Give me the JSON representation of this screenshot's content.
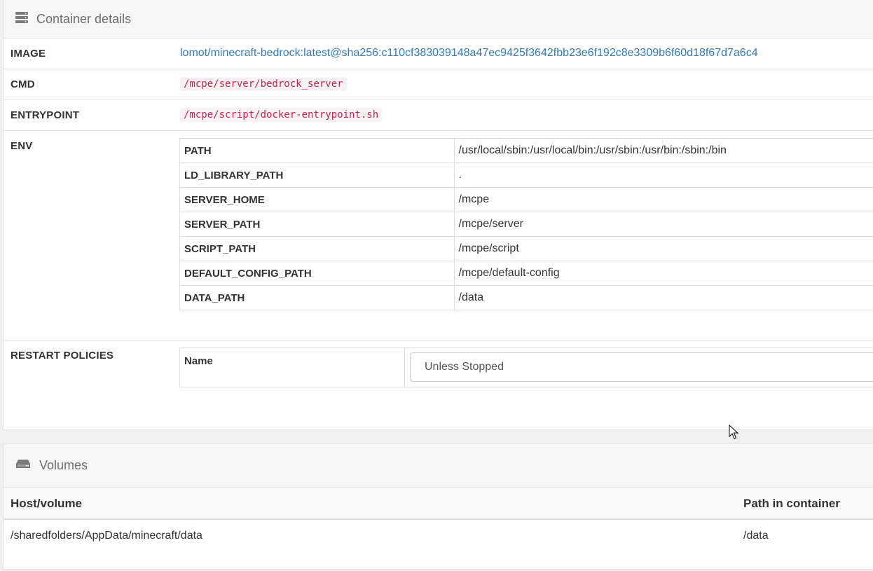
{
  "details": {
    "title": "Container details",
    "image_label": "IMAGE",
    "image_value": "lomot/minecraft-bedrock:latest@sha256:c110cf383039148a47ec9425f3642fbb23e6f192c8e3309b6f60d18f67d7a6c4",
    "cmd_label": "CMD",
    "cmd_value": "/mcpe/server/bedrock_server",
    "entrypoint_label": "ENTRYPOINT",
    "entrypoint_value": "/mcpe/script/docker-entrypoint.sh",
    "env_label": "ENV",
    "env": [
      {
        "key": "PATH",
        "value": "/usr/local/sbin:/usr/local/bin:/usr/sbin:/usr/bin:/sbin:/bin"
      },
      {
        "key": "LD_LIBRARY_PATH",
        "value": "."
      },
      {
        "key": "SERVER_HOME",
        "value": "/mcpe"
      },
      {
        "key": "SERVER_PATH",
        "value": "/mcpe/server"
      },
      {
        "key": "SCRIPT_PATH",
        "value": "/mcpe/script"
      },
      {
        "key": "DEFAULT_CONFIG_PATH",
        "value": "/mcpe/default-config"
      },
      {
        "key": "DATA_PATH",
        "value": "/data"
      }
    ],
    "restart_label": "RESTART POLICIES",
    "restart_name_label": "Name",
    "restart_value": "Unless Stopped"
  },
  "volumes": {
    "title": "Volumes",
    "col_host": "Host/volume",
    "col_path": "Path in container",
    "rows": [
      {
        "host": "/sharedfolders/AppData/minecraft/data",
        "path": "/data"
      }
    ]
  },
  "icons": {
    "details_icon": "server-icon",
    "volumes_icon": "hdd-icon"
  },
  "colors": {
    "link": "#337ab7",
    "code": "#c7254e"
  }
}
